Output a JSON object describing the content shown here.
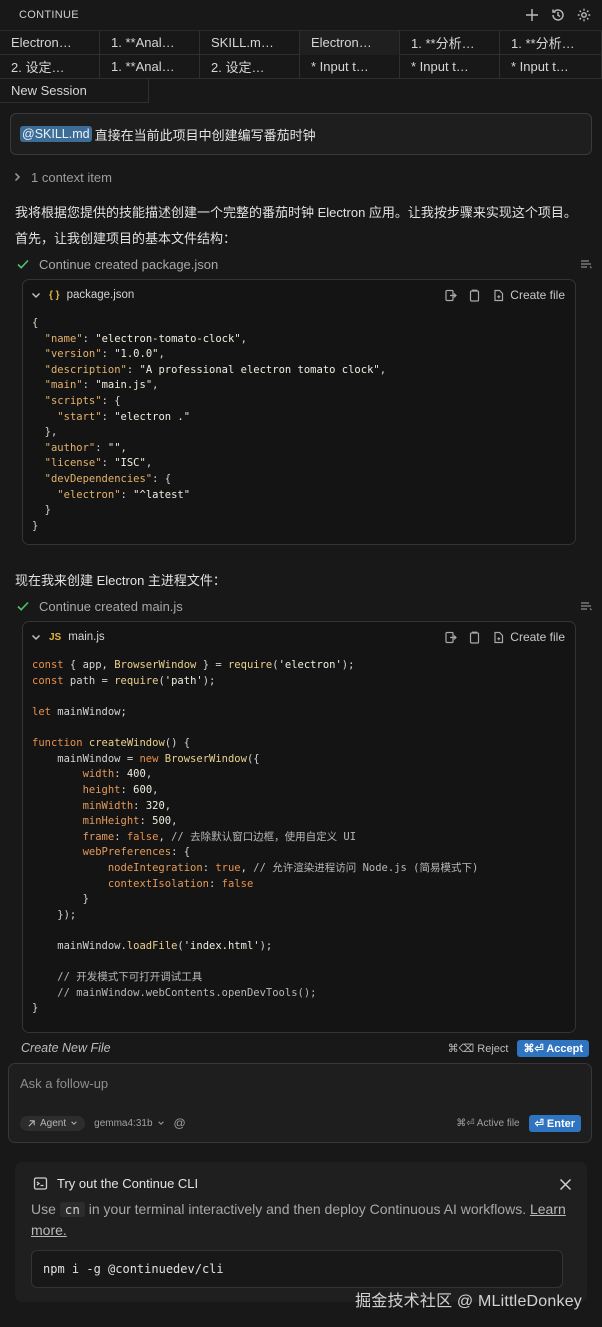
{
  "titlebar": {
    "title": "CONTINUE",
    "icons": [
      "plus-icon",
      "history-icon",
      "gear-icon"
    ]
  },
  "tabs": {
    "row1": [
      "Electron…",
      "1. **Anal…",
      "SKILL.m…",
      "Electron…",
      "1. **分析…",
      "1. **分析…"
    ],
    "row2": [
      "2. 设定…",
      "1. **Anal…",
      "2. 设定…",
      "* Input t…",
      "* Input t…",
      "* Input t…"
    ],
    "row3": [
      "New Session"
    ],
    "active_index_row1": 3
  },
  "prompt": {
    "mention": "@SKILL.md",
    "text": "直接在当前此项目中创建编写番茄时钟"
  },
  "context": {
    "label": "1 context item"
  },
  "response": {
    "intro": "我将根据您提供的技能描述创建一个完整的番茄时钟 Electron 应用。让我按步骤来实现这个项目。",
    "step1": "首先，让我创建项目的基本文件结构：",
    "status1": "Continue created package.json",
    "step2": "现在我来创建 Electron 主进程文件：",
    "status2": "Continue created main.js"
  },
  "codeblocks": {
    "pkg": {
      "filename": "package.json",
      "icon": "{ }",
      "create_label": "Create file"
    },
    "main": {
      "filename": "main.js",
      "icon": "JS",
      "create_label": "Create file"
    }
  },
  "gen_bar": {
    "label": "Create New File",
    "reject": "⌘⌫ Reject",
    "accept": "⌘⏎ Accept"
  },
  "followup": {
    "placeholder": "Ask a follow-up",
    "mode": "Agent",
    "model": "gemma4:31b",
    "at": "@",
    "active_file": "⌘⏎ Active file",
    "enter": "⏎ Enter"
  },
  "cli": {
    "title": "Try out the Continue CLI",
    "desc_before": "Use",
    "desc_code": "cn",
    "desc_after": "in your terminal interactively and then deploy Continuous AI workflows.",
    "learn_more": "Learn more.",
    "command": "npm i -g @continuedev/cli"
  },
  "watermark": "掘金技术社区 @ MLittleDonkey"
}
